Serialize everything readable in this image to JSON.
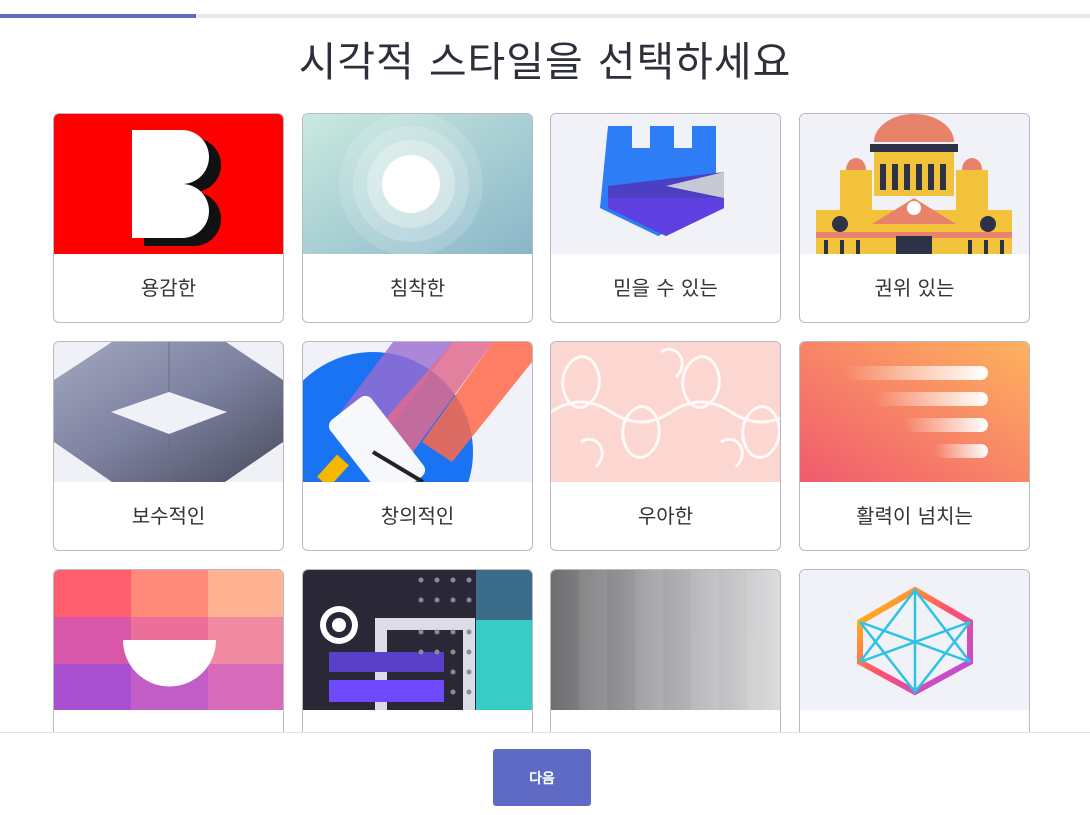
{
  "progress": {
    "fraction": 0.18
  },
  "page": {
    "title": "시각적 스타일을 선택하세요"
  },
  "styles": [
    {
      "label": "용감한",
      "icon": "bold-b-icon"
    },
    {
      "label": "침착한",
      "icon": "concentric-circles-icon"
    },
    {
      "label": "믿을 수 있는",
      "icon": "castle-tower-icon"
    },
    {
      "label": "권위 있는",
      "icon": "capitol-building-icon"
    },
    {
      "label": "보수적인",
      "icon": "diamond-pattern-icon"
    },
    {
      "label": "창의적인",
      "icon": "paint-roller-icon"
    },
    {
      "label": "우아한",
      "icon": "damask-pattern-icon"
    },
    {
      "label": "활력이 넘치는",
      "icon": "speed-lines-icon"
    },
    {
      "label": "",
      "icon": "color-blocks-icon"
    },
    {
      "label": "",
      "icon": "geometric-dark-icon"
    },
    {
      "label": "",
      "icon": "silver-gradient-icon"
    },
    {
      "label": "",
      "icon": "hexagon-network-icon"
    }
  ],
  "footer": {
    "next_label": "다음"
  },
  "colors": {
    "accent": "#5f6ac4",
    "progress": "#5f6abf"
  }
}
